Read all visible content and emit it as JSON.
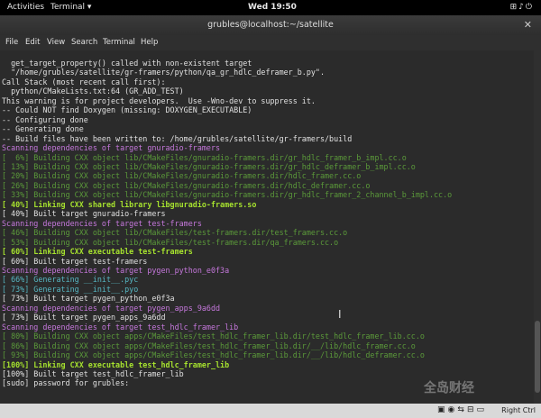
{
  "topbar": {
    "activities": "Activities",
    "app_label": "Terminal ▾",
    "clock": "Wed 19:50",
    "tray_icons": [
      "network-icon",
      "volume-icon",
      "power-icon"
    ]
  },
  "window": {
    "title": "grubles@localhost:~/satellite"
  },
  "menu": {
    "items": [
      "File",
      "Edit",
      "View",
      "Search",
      "Terminal",
      "Help"
    ]
  },
  "terminal_lines": [
    {
      "text": "  get_target_property() called with non-existent target",
      "color": "white"
    },
    {
      "text": "  \"/home/grubles/satellite/gr-framers/python/qa_gr_hdlc_deframer_b.py\".",
      "color": "white"
    },
    {
      "text": "Call Stack (most recent call first):",
      "color": "white"
    },
    {
      "text": "  python/CMakeLists.txt:64 (GR_ADD_TEST)",
      "color": "white"
    },
    {
      "text": "This warning is for project developers.  Use -Wno-dev to suppress it.",
      "color": "white"
    },
    {
      "text": "",
      "color": "white"
    },
    {
      "text": "-- Could NOT find Doxygen (missing: DOXYGEN_EXECUTABLE)",
      "color": "white"
    },
    {
      "text": "-- Configuring done",
      "color": "white"
    },
    {
      "text": "-- Generating done",
      "color": "white"
    },
    {
      "text": "-- Build files have been written to: /home/grubles/satellite/gr-framers/build",
      "color": "white"
    },
    {
      "text": "Scanning dependencies of target gnuradio-framers",
      "color": "mag"
    },
    {
      "text": "[  6%] Building CXX object lib/CMakeFiles/gnuradio-framers.dir/gr_hdlc_framer_b_impl.cc.o",
      "color": "dim"
    },
    {
      "text": "[ 13%] Building CXX object lib/CMakeFiles/gnuradio-framers.dir/gr_hdlc_deframer_b_impl.cc.o",
      "color": "dim"
    },
    {
      "text": "[ 20%] Building CXX object lib/CMakeFiles/gnuradio-framers.dir/hdlc_framer.cc.o",
      "color": "dim"
    },
    {
      "text": "[ 26%] Building CXX object lib/CMakeFiles/gnuradio-framers.dir/hdlc_deframer.cc.o",
      "color": "dim"
    },
    {
      "text": "[ 33%] Building CXX object lib/CMakeFiles/gnuradio-framers.dir/gr_hdlc_framer_2_channel_b_impl.cc.o",
      "color": "dim"
    },
    {
      "text": "[ 40%] Linking CXX shared library libgnuradio-framers.so",
      "color": "bold"
    },
    {
      "text": "[ 40%] Built target gnuradio-framers",
      "color": "white"
    },
    {
      "text": "Scanning dependencies of target test-framers",
      "color": "mag"
    },
    {
      "text": "[ 46%] Building CXX object lib/CMakeFiles/test-framers.dir/test_framers.cc.o",
      "color": "dim"
    },
    {
      "text": "[ 53%] Building CXX object lib/CMakeFiles/test-framers.dir/qa_framers.cc.o",
      "color": "dim"
    },
    {
      "text": "[ 60%] Linking CXX executable test-framers",
      "color": "bold"
    },
    {
      "text": "[ 60%] Built target test-framers",
      "color": "white"
    },
    {
      "text": "Scanning dependencies of target pygen_python_e0f3a",
      "color": "mag"
    },
    {
      "text": "[ 66%] Generating __init__.pyc",
      "color": "cyan"
    },
    {
      "text": "[ 73%] Generating __init__.pyo",
      "color": "cyan"
    },
    {
      "text": "[ 73%] Built target pygen_python_e0f3a",
      "color": "white"
    },
    {
      "text": "Scanning dependencies of target pygen_apps_9a6dd",
      "color": "mag"
    },
    {
      "text": "[ 73%] Built target pygen_apps_9a6dd",
      "color": "white"
    },
    {
      "text": "Scanning dependencies of target test_hdlc_framer_lib",
      "color": "mag"
    },
    {
      "text": "[ 80%] Building CXX object apps/CMakeFiles/test_hdlc_framer_lib.dir/test_hdlc_framer_lib.cc.o",
      "color": "dim"
    },
    {
      "text": "[ 86%] Building CXX object apps/CMakeFiles/test_hdlc_framer_lib.dir/__/lib/hdlc_framer.cc.o",
      "color": "dim"
    },
    {
      "text": "[ 93%] Building CXX object apps/CMakeFiles/test_hdlc_framer_lib.dir/__/lib/hdlc_deframer.cc.o",
      "color": "dim"
    },
    {
      "text": "[100%] Linking CXX executable test_hdlc_framer_lib",
      "color": "bold"
    },
    {
      "text": "[100%] Built target test_hdlc_framer_lib",
      "color": "white"
    },
    {
      "text": "[sudo] password for grubles:",
      "color": "white"
    }
  ],
  "statusbar": {
    "host_key": "Right Ctrl"
  },
  "watermark_text": "全岛财经"
}
